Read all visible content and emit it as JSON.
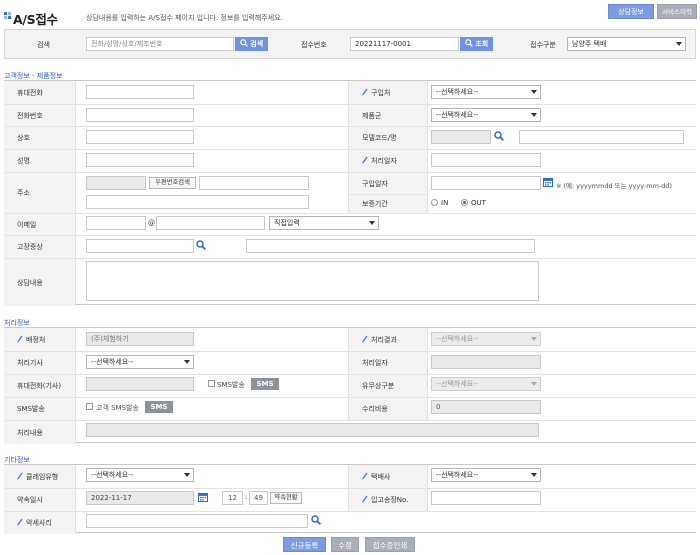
{
  "header": {
    "title": "A/S접수",
    "description": "상담내용를 입력하는 A/S접수 페이지 입니다. 정보를 입력해주세요.",
    "btn_consult": "상담정보",
    "btn_history": "서비스이력"
  },
  "search": {
    "label": "검색",
    "placeholder": "전화/성명/상호/제조번호",
    "search_btn": "검색",
    "receipt_label": "접수번호",
    "receipt_value": "20221117-0001",
    "lookup_btn": "조회",
    "type_label": "접수구분",
    "type_value": "남양주 택배"
  },
  "customer": {
    "section_title": "고객정보 - 제품정보",
    "mobile": "휴대전화",
    "purchase_place": "구입처",
    "purchase_place_value": "--선택하세요--",
    "phone": "전화번호",
    "product_group": "제품군",
    "product_group_value": "--선택하세요--",
    "company": "상호",
    "model_code": "모델코드/명",
    "name": "성명",
    "process_date": "처리일자",
    "address": "주소",
    "zip_btn": "우편번호검색",
    "purchase_date": "구입일자",
    "date_hint": "※ (예: yyyymmdd 또는 yyyy-mm-dd)",
    "warranty": "보증기간",
    "warranty_in": "IN",
    "warranty_out": "OUT",
    "email": "이메일",
    "email_at": "@",
    "email_domain": "직접입력",
    "symptom": "고장증상",
    "consult": "상담내용"
  },
  "process": {
    "section_title": "처리정보",
    "dispatch": "배정처",
    "dispatch_value": "(주)체험하기",
    "result": "처리결과",
    "result_value": "--선택하세요--",
    "technician": "처리기사",
    "technician_value": "--선택하세요--",
    "proc_date": "처리일자",
    "tech_mobile": "휴대전화(기사)",
    "sms_send_label": "SMS발송",
    "sms_btn": "SMS",
    "paid_type": "유무상구분",
    "paid_type_value": "--선택하세요--",
    "sms_send": "SMS발송",
    "customer_sms": "고객 SMS발송",
    "repair_cost": "수리비용",
    "repair_cost_value": "0",
    "content": "처리내용"
  },
  "other": {
    "section_title": "기타정보",
    "claim_type": "클레임유형",
    "claim_type_value": "--선택하세요--",
    "courier": "택배사",
    "courier_value": "--선택하세요--",
    "appt_date": "약속일시",
    "appt_date_value": "2022-11-17",
    "appt_hour": "12",
    "appt_min": "49",
    "appt_btn": "약속현황",
    "invoice": "입고송장No.",
    "bad_debt": "악세사리"
  },
  "footer": {
    "new_btn": "신규등록",
    "edit_btn": "수정",
    "print_btn": "접수증인쇄"
  },
  "colors": {
    "accent": "#6f93e0",
    "section": "#2d5cc4",
    "gray_btn": "#a9aeb8"
  }
}
